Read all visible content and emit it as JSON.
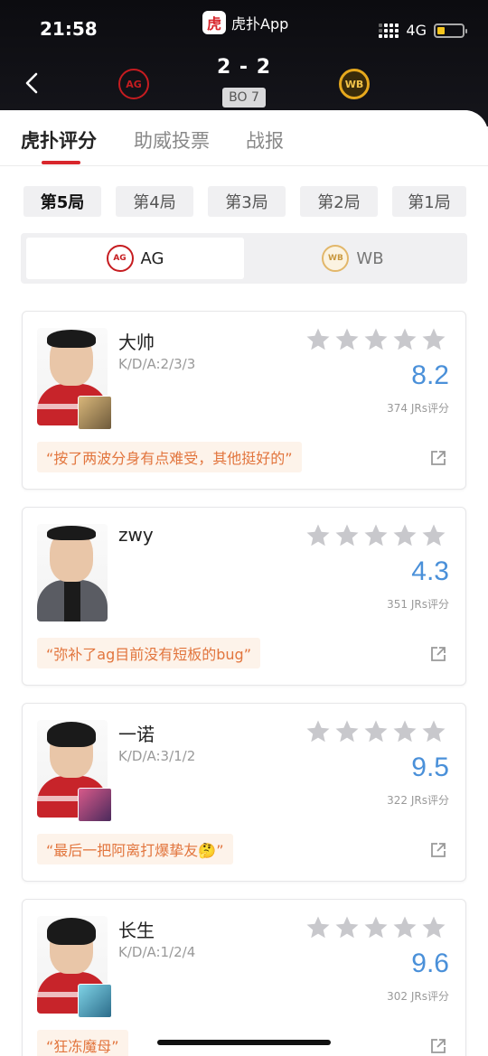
{
  "status_bar": {
    "time": "21:58",
    "network": "4G"
  },
  "app": {
    "logo_text": "虎",
    "name": "虎扑App"
  },
  "match": {
    "score": "2 - 2",
    "format": "BO 7",
    "team_left_badge": "AG",
    "team_right_badge": "WB"
  },
  "tabs": [
    {
      "label": "虎扑评分",
      "active": true
    },
    {
      "label": "助威投票",
      "active": false
    },
    {
      "label": "战报",
      "active": false
    }
  ],
  "rounds": [
    "第5局",
    "第4局",
    "第3局",
    "第2局",
    "第1局"
  ],
  "teams": [
    {
      "name": "AG",
      "badge": "AG"
    },
    {
      "name": "WB",
      "badge": "WB"
    }
  ],
  "players": [
    {
      "name": "大帅",
      "kda": "K/D/A:2/3/3",
      "rating": "8.2",
      "votes": "374 JRs评分",
      "quote": "“按了两波分身有点难受，其他挺好的”"
    },
    {
      "name": "zwy",
      "kda": "",
      "rating": "4.3",
      "votes": "351 JRs评分",
      "quote": "“弥补了ag目前没有短板的bug”"
    },
    {
      "name": "一诺",
      "kda": "K/D/A:3/1/2",
      "rating": "9.5",
      "votes": "322 JRs评分",
      "quote": "“最后一把阿离打爆挚友🤔”"
    },
    {
      "name": "长生",
      "kda": "K/D/A:1/2/4",
      "rating": "9.6",
      "votes": "302 JRs评分",
      "quote": "“狂冻魔母”"
    }
  ],
  "colors": {
    "accent_red": "#d8262c",
    "rating_blue": "#4a90d9",
    "quote_orange": "#e2753d",
    "battery_yellow": "#f5c51d"
  },
  "icons": {
    "back": "chevron-left-icon",
    "star": "star-icon",
    "share": "share-icon"
  }
}
